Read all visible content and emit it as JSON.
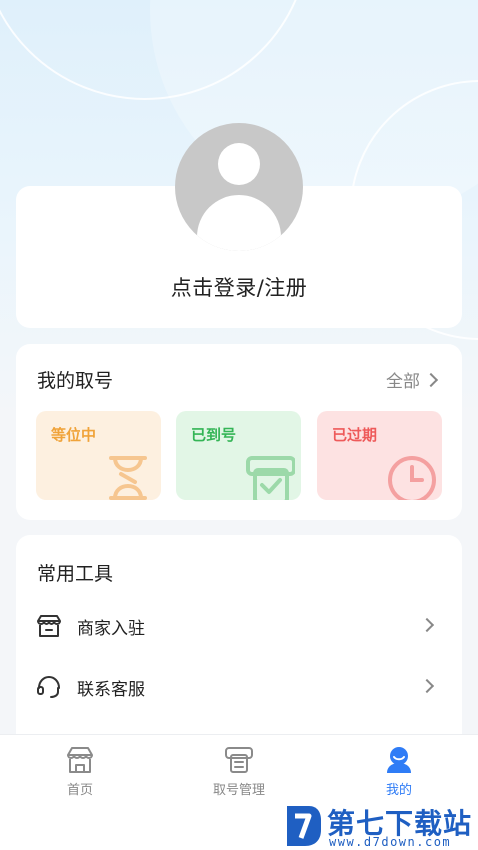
{
  "profile": {
    "login_text": "点击登录/注册"
  },
  "my_queue": {
    "title": "我的取号",
    "all_label": "全部",
    "statuses": [
      {
        "label": "等位中",
        "icon": "hourglass-icon",
        "color": "#f0a33a"
      },
      {
        "label": "已到号",
        "icon": "ticket-printer-icon",
        "color": "#34b556"
      },
      {
        "label": "已过期",
        "icon": "clock-icon",
        "color": "#ee5a5a"
      }
    ]
  },
  "tools": {
    "title": "常用工具",
    "items": [
      {
        "label": "商家入驻",
        "icon": "storefront-icon"
      },
      {
        "label": "联系客服",
        "icon": "headset-icon"
      }
    ]
  },
  "tabbar": {
    "items": [
      {
        "label": "首页",
        "icon": "home-store-icon"
      },
      {
        "label": "取号管理",
        "icon": "ticket-printer-icon"
      },
      {
        "label": "我的",
        "icon": "user-icon",
        "active": true
      }
    ],
    "active_color": "#2f7cf6"
  },
  "watermark": {
    "title": "第七下载站",
    "url": "www.d7down.com"
  }
}
